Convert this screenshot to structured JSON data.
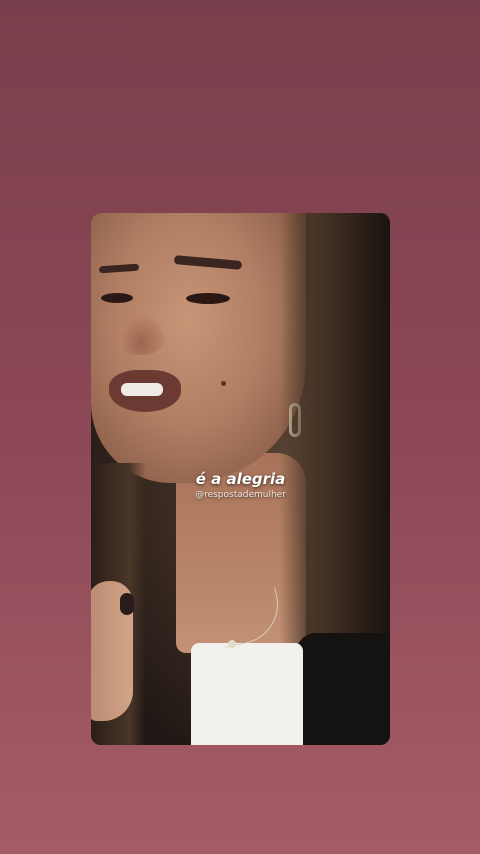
{
  "background": {
    "gradient_top": "#7a3f4c",
    "gradient_bottom": "#a55c66"
  },
  "story": {
    "caption": "é a alegria",
    "watermark": "@respostademulher",
    "caption_color": "#ffffff"
  }
}
